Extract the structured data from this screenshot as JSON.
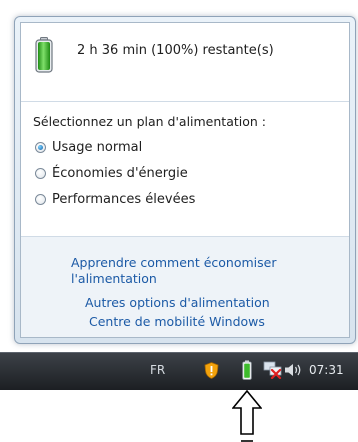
{
  "flyout": {
    "status_text": "2 h 36 min (100%) restante(s)",
    "battery_percent": 100,
    "plan_prompt": "Sélectionnez un plan d'alimentation :",
    "plans": [
      {
        "label": "Usage normal",
        "selected": true
      },
      {
        "label": "Économies d'énergie",
        "selected": false
      },
      {
        "label": "Performances élevées",
        "selected": false
      }
    ],
    "links": {
      "learn_line1": "Apprendre comment économiser",
      "learn_line2": "l'alimentation",
      "more_options": "Autres options d'alimentation",
      "mobility_center": "Centre de mobilité Windows"
    }
  },
  "taskbar": {
    "language": "FR",
    "clock": "07:31",
    "icons": [
      "shield-warning-icon",
      "battery-icon",
      "network-disconnected-icon",
      "volume-icon"
    ]
  },
  "colors": {
    "link": "#1c5aa6",
    "battery_green": "#3dbb2c",
    "taskbar": "#23272c"
  }
}
